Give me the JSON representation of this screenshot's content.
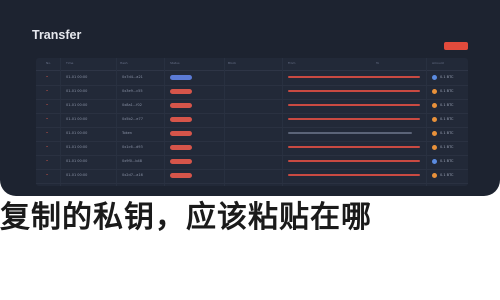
{
  "app": {
    "title": "Transfer",
    "action_color": "#e24b3c"
  },
  "table": {
    "headers": [
      "No.",
      "Time",
      "Hash",
      "Status",
      "Block",
      "From",
      "To",
      "Amount"
    ],
    "rows": [
      {
        "no": "•",
        "time": "01-01 00:00",
        "hash": "0x7d4...a21",
        "status": "blue",
        "block": "",
        "bar": "red",
        "amount_dot": "blue",
        "amount": "0.1 BTC"
      },
      {
        "no": "•",
        "time": "01-01 00:00",
        "hash": "0x3e9...c55",
        "status": "red",
        "block": "",
        "bar": "red",
        "amount_dot": "orange",
        "amount": "0.1 BTC"
      },
      {
        "no": "•",
        "time": "01-01 00:00",
        "hash": "0x8a1...f02",
        "status": "red",
        "block": "",
        "bar": "red",
        "amount_dot": "orange",
        "amount": "0.1 BTC"
      },
      {
        "no": "•",
        "time": "01-01 00:00",
        "hash": "0x5b2...e77",
        "status": "red",
        "block": "",
        "bar": "red",
        "amount_dot": "orange",
        "amount": "0.1 BTC"
      },
      {
        "no": "•",
        "time": "01-01 00:00",
        "hash": "Token",
        "status": "red",
        "block": "",
        "bar": "light",
        "amount_dot": "orange",
        "amount": "0.1 BTC"
      },
      {
        "no": "•",
        "time": "01-01 00:00",
        "hash": "0x1c6...d93",
        "status": "red",
        "block": "",
        "bar": "red",
        "amount_dot": "orange",
        "amount": "0.1 BTC"
      },
      {
        "no": "•",
        "time": "01-01 00:00",
        "hash": "0x9f0...b48",
        "status": "red",
        "block": "",
        "bar": "red",
        "amount_dot": "blue",
        "amount": "0.1 BTC"
      },
      {
        "no": "•",
        "time": "01-01 00:00",
        "hash": "0x2d7...a16",
        "status": "red",
        "block": "",
        "bar": "red",
        "amount_dot": "orange",
        "amount": "0.1 BTC"
      }
    ]
  },
  "banner": {
    "text": "复制的私钥，应该粘贴在哪"
  }
}
